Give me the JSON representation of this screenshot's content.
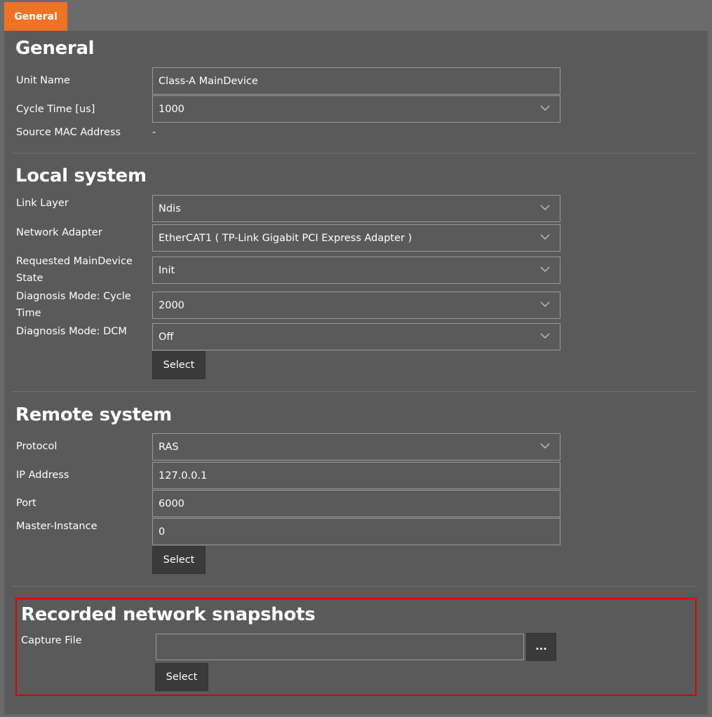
{
  "tab": {
    "label": "General"
  },
  "general": {
    "title": "General",
    "unit_name_label": "Unit Name",
    "unit_name_value": "Class-A MainDevice",
    "cycle_time_label": "Cycle Time [us]",
    "cycle_time_value": "1000",
    "mac_label": "Source MAC Address",
    "mac_value": "-"
  },
  "local": {
    "title": "Local system",
    "link_layer_label": "Link Layer",
    "link_layer_value": "Ndis",
    "adapter_label": "Network Adapter",
    "adapter_value": "EtherCAT1 ( TP-Link Gigabit PCI Express Adapter )",
    "state_label": "Requested MainDevice State",
    "state_value": "Init",
    "diag_cycle_label": "Diagnosis Mode: Cycle Time",
    "diag_cycle_value": "2000",
    "diag_dcm_label": "Diagnosis Mode: DCM",
    "diag_dcm_value": "Off",
    "select_label": "Select"
  },
  "remote": {
    "title": "Remote system",
    "protocol_label": "Protocol",
    "protocol_value": "RAS",
    "ip_label": "IP Address",
    "ip_value": "127.0.0.1",
    "port_label": "Port",
    "port_value": "6000",
    "instance_label": "Master-Instance",
    "instance_value": "0",
    "select_label": "Select"
  },
  "snapshots": {
    "title": "Recorded network snapshots",
    "capture_label": "Capture File",
    "capture_value": "",
    "browse_label": "...",
    "select_label": "Select"
  },
  "colors": {
    "accent": "#ee7325",
    "panel": "#5a5a5a",
    "highlight_border": "#e00000",
    "button": "#3a3a3a"
  }
}
